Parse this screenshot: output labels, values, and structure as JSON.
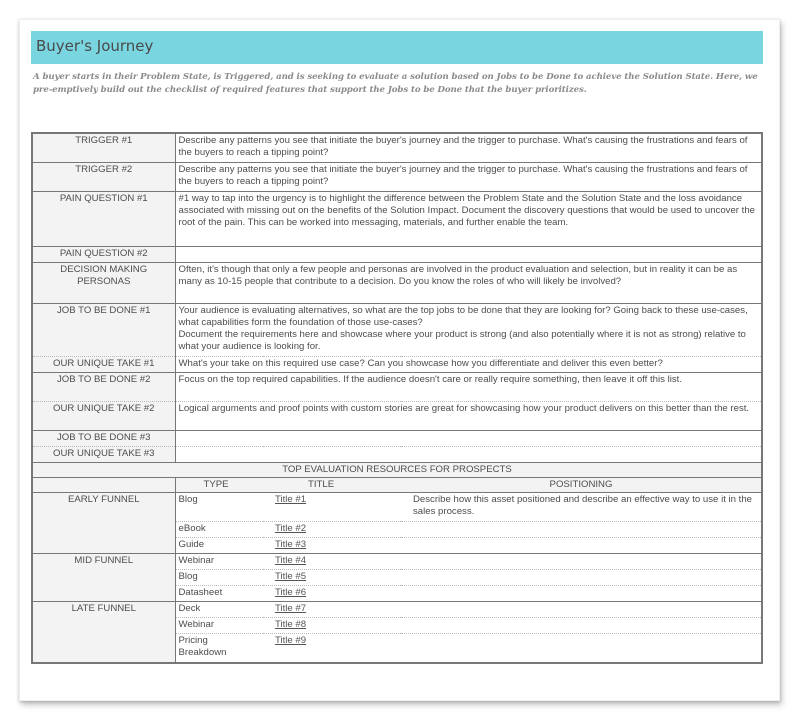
{
  "header": {
    "title": "Buyer's Journey",
    "accent_color": "#79d5e0"
  },
  "intro": "A buyer starts in their Problem State, is Triggered, and is seeking to evaluate a solution based on Jobs to be Done to achieve the Solution State. Here, we pre-emptively build out the checklist of required features that support the Jobs to be Done that the buyer prioritizes.",
  "rows": [
    {
      "label": "TRIGGER #1",
      "text": "Describe any patterns you see that initiate the buyer's journey and the trigger to purchase. What's causing the frustrations and fears of the buyers to reach a tipping point?"
    },
    {
      "label": "TRIGGER #2",
      "text": "Describe any patterns you see that initiate the buyer's journey and the trigger to purchase. What's causing the frustrations and fears of the buyers to reach a tipping point?"
    },
    {
      "label": "PAIN QUESTION #1",
      "text": "#1 way to tap into the urgency is to highlight the difference between the Problem State and the Solution State and the loss avoidance associated with missing out on the benefits of the Solution Impact. Document the discovery questions that would be used to uncover the root of the pain. This can be worked into messaging, materials, and further enable the team."
    },
    {
      "label": "PAIN QUESTION #2",
      "text": ""
    },
    {
      "label": "DECISION MAKING PERSONAS",
      "text": "Often, it's though that only a few people and personas are involved in the product evaluation and selection, but in reality it can be as many as 10-15 people that contribute to a decision. Do you know the roles of who will likely be involved?"
    },
    {
      "label": "JOB TO BE DONE #1",
      "text": "Your audience is evaluating alternatives, so what are the top jobs to be done that they are looking for? Going back to these use-cases, what capabilities form the foundation of those use-cases?",
      "text2": "Document the requirements here and showcase where your product is strong (and also potentially where it is not as strong) relative to what your audience is looking for."
    },
    {
      "label": "OUR UNIQUE TAKE #1",
      "text": "What's your take on this required use case? Can you showcase how you differentiate and deliver this even better?"
    },
    {
      "label": "JOB TO BE DONE #2",
      "text": "Focus on the top required capabilities. If the audience doesn't care or really require something, then leave it off this list."
    },
    {
      "label": "OUR UNIQUE TAKE #2",
      "text": "Logical arguments and proof points with custom stories are great for showcasing how your product delivers on this better than the rest."
    },
    {
      "label": "JOB TO BE DONE #3",
      "text": ""
    },
    {
      "label": "OUR UNIQUE TAKE #3",
      "text": ""
    }
  ],
  "resources": {
    "heading": "TOP EVALUATION RESOURCES FOR PROSPECTS",
    "columns": {
      "type": "TYPE",
      "title": "TITLE",
      "positioning": "POSITIONING"
    },
    "positioning_note": "Describe how this asset positioned and describe an effective way to use it in the sales process.",
    "funnels": [
      {
        "stage": "EARLY FUNNEL",
        "items": [
          {
            "type": "Blog",
            "title": "Title #1"
          },
          {
            "type": "eBook",
            "title": "Title #2"
          },
          {
            "type": "Guide",
            "title": "Title #3"
          }
        ]
      },
      {
        "stage": "MID FUNNEL",
        "items": [
          {
            "type": "Webinar",
            "title": "Title #4"
          },
          {
            "type": "Blog",
            "title": "Title #5"
          },
          {
            "type": "Datasheet",
            "title": "Title #6"
          }
        ]
      },
      {
        "stage": "LATE FUNNEL",
        "items": [
          {
            "type": "Deck",
            "title": "Title #7"
          },
          {
            "type": "Webinar",
            "title": "Title #8"
          },
          {
            "type": "Pricing Breakdown",
            "title": "Title #9"
          }
        ]
      }
    ]
  }
}
